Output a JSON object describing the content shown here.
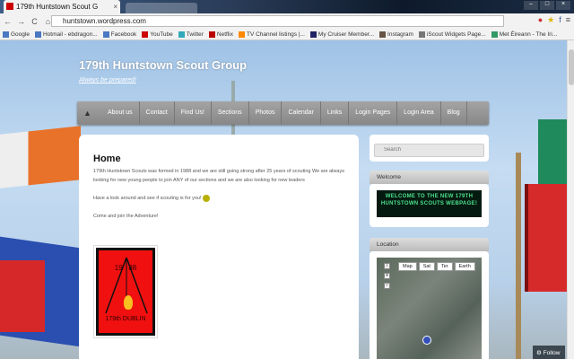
{
  "browser": {
    "tab_title": "179th Huntstown Scout G",
    "url": "huntstown.wordpress.com",
    "bookmarks": [
      "Google",
      "Hotmail - ebdragon...",
      "Facebook",
      "YouTube",
      "Twitter",
      "Netflix",
      "TV Channel listings |...",
      "My Cruiser Member...",
      "Instagram",
      "iScout Widgets Page...",
      "Met Éireann - The Iri..."
    ]
  },
  "site": {
    "title": "179th Huntstown Scout Group",
    "tagline": "Always be prepared!",
    "nav": [
      "About us",
      "Contact",
      "Find Us!",
      "Sections",
      "Photos",
      "Calendar",
      "Links",
      "Login Pages",
      "Login Area",
      "Blog"
    ]
  },
  "main": {
    "heading": "Home",
    "para1": "179th Huntstown Scouts was formed in 1988 and we are still going strong after 25 years of scouting We are always looking for new young people to join ANY of our sections and we are also looking for new leaders",
    "para2": "Have a look around and see if scouting is for you!",
    "para3": "Come and join the Adventure!",
    "badge": {
      "year_left": "19",
      "year_right": "88",
      "name": "179th DUBLIN"
    }
  },
  "sidebar": {
    "search_placeholder": "Search",
    "welcome_title": "Welcome",
    "welcome_banner": "WELCOME TO THE NEW 179TH HUNTSTOWN SCOUTS WEBPAGE!",
    "location_title": "Location",
    "map_buttons": [
      "Map",
      "Sat",
      "Ter",
      "Earth"
    ]
  },
  "follow": "Follow"
}
